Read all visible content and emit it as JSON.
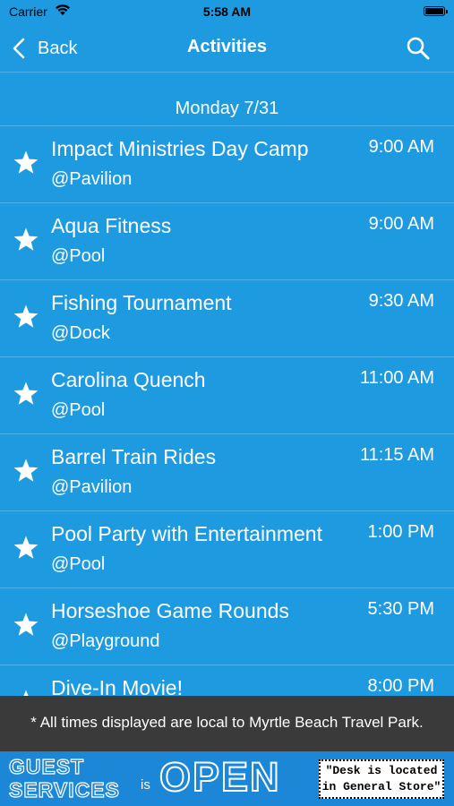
{
  "status_bar": {
    "carrier": "Carrier",
    "time": "5:58 AM"
  },
  "nav": {
    "back_label": "Back",
    "title": "Activities"
  },
  "section": {
    "date": "Monday 7/31"
  },
  "activities": [
    {
      "name": "Impact Ministries Day Camp",
      "location": "@Pavilion",
      "time": "9:00 AM"
    },
    {
      "name": "Aqua Fitness",
      "location": "@Pool",
      "time": "9:00 AM"
    },
    {
      "name": "Fishing Tournament",
      "location": "@Dock",
      "time": "9:30 AM"
    },
    {
      "name": "Carolina Quench",
      "location": "@Pool",
      "time": "11:00 AM"
    },
    {
      "name": "Barrel Train Rides",
      "location": "@Pavilion",
      "time": "11:15 AM"
    },
    {
      "name": "Pool Party with Entertainment",
      "location": "@Pool",
      "time": "1:00 PM"
    },
    {
      "name": "Horseshoe Game Rounds",
      "location": "@Playground",
      "time": "5:30 PM"
    },
    {
      "name": "Dive-In Movie!",
      "location": "",
      "time": "8:00 PM"
    }
  ],
  "footer_note": "* All times displayed are local to Myrtle Beach Travel Park.",
  "banner": {
    "line1": "GUEST",
    "line2": "SERVICES",
    "is": "is",
    "open": "OPEN",
    "desk_line1": "\"Desk is located",
    "desk_line2": "in General Store\""
  },
  "colors": {
    "background": "#1E9BE0",
    "footer": "#3A3A3A",
    "banner": "#1B87D6"
  },
  "icons": [
    "wifi-icon",
    "battery-icon",
    "back-chevron-icon",
    "search-icon",
    "star-icon"
  ]
}
